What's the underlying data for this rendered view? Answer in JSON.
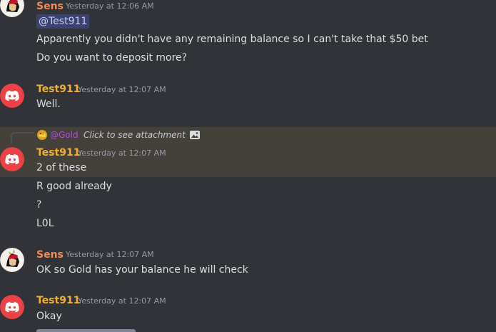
{
  "messages": [
    {
      "author": "Sens",
      "timestamp": "Yesterday at 12:06 AM",
      "mention": "@Test911",
      "lines": [
        "Apparently you didn't have any remaining balance so I can't take that $50 bet",
        "Do you want to deposit more?"
      ]
    },
    {
      "author": "Test911",
      "timestamp": "Yesterday at 12:07 AM",
      "lines": [
        "Well."
      ]
    },
    {
      "reply": {
        "name": "@Gold",
        "text": "Click to see attachment",
        "icon": "image-icon"
      },
      "author": "Test911",
      "timestamp": "Yesterday at 12:07 AM",
      "lines": [
        "2 of these",
        "R good already",
        "?",
        "L0L"
      ]
    },
    {
      "author": "Sens",
      "timestamp": "Yesterday at 12:07 AM",
      "lines": [
        "OK so Gold has your balance he will check"
      ]
    },
    {
      "author": "Test911",
      "timestamp": "Yesterday at 12:07 AM",
      "lines": [
        "Okay"
      ]
    }
  ],
  "colors": {
    "background": "#313338",
    "sens_name": "#f28a52",
    "test_name": "#f0b132",
    "reply_highlight": "#44403a",
    "discord_avatar": "#ed4245"
  }
}
